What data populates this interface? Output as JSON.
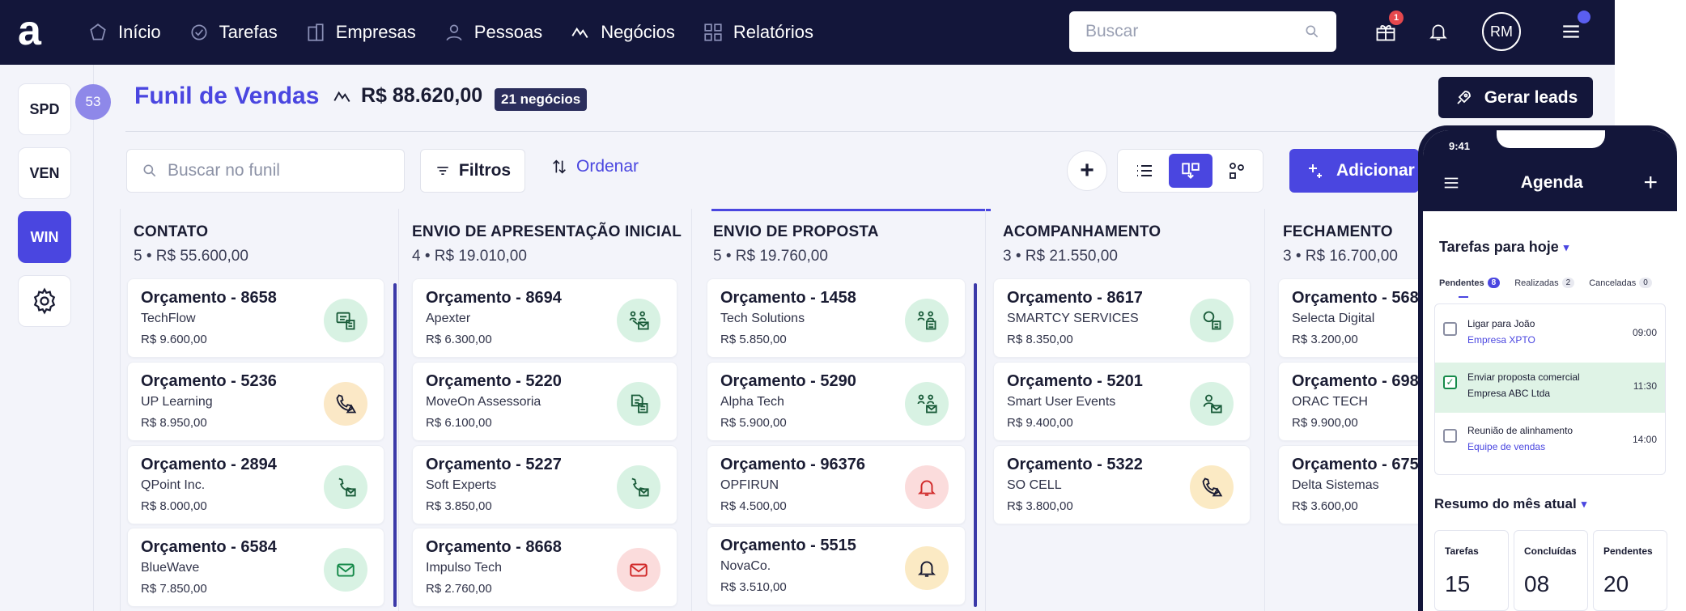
{
  "nav": {
    "logo": "a",
    "items": [
      {
        "label": "Início",
        "icon": "home-icon"
      },
      {
        "label": "Tarefas",
        "icon": "tasks-icon"
      },
      {
        "label": "Empresas",
        "icon": "building-icon"
      },
      {
        "label": "Pessoas",
        "icon": "person-icon"
      },
      {
        "label": "Negócios",
        "icon": "deals-icon"
      },
      {
        "label": "Relatórios",
        "icon": "reports-icon"
      }
    ],
    "search_placeholder": "Buscar",
    "gift_badge": "1",
    "avatar_initials": "RM"
  },
  "sidebar": {
    "buttons": [
      "SPD",
      "VEN",
      "WIN"
    ],
    "active": "WIN",
    "count": "53"
  },
  "header": {
    "title": "Funil de Vendas",
    "total": "R$ 88.620,00",
    "deals_badge": "21 negócios",
    "gen_leads": "Gerar leads"
  },
  "toolbar": {
    "search_placeholder": "Buscar no funil",
    "filters": "Filtros",
    "order": "Ordenar",
    "add": "Adicionar"
  },
  "columns": [
    {
      "name": "CONTATO",
      "count": "5",
      "sum": "R$ 55.600,00",
      "cards": [
        {
          "title": "Orçamento - 8658",
          "company": "TechFlow",
          "value": "R$ 9.600,00",
          "icon": "chat-document-icon",
          "tone": "green"
        },
        {
          "title": "Orçamento - 5236",
          "company": "UP Learning",
          "value": "R$ 8.950,00",
          "icon": "phone-warning-icon",
          "tone": "orange"
        },
        {
          "title": "Orçamento - 2894",
          "company": "QPoint Inc.",
          "value": "R$ 8.000,00",
          "icon": "phone-mail-icon",
          "tone": "green"
        },
        {
          "title": "Orçamento - 6584",
          "company": "BlueWave",
          "value": "R$ 7.850,00",
          "icon": "mail-icon",
          "tone": "green"
        }
      ]
    },
    {
      "name": "ENVIO DE APRESENTAÇÃO INICIAL",
      "count": "4",
      "sum": "R$ 19.010,00",
      "cards": [
        {
          "title": "Orçamento - 8694",
          "company": "Apexter",
          "value": "R$ 6.300,00",
          "icon": "meeting-mail-icon",
          "tone": "green"
        },
        {
          "title": "Orçamento - 5220",
          "company": "MoveOn Assessoria",
          "value": "R$ 6.100,00",
          "icon": "document-icon",
          "tone": "green"
        },
        {
          "title": "Orçamento - 5227",
          "company": "Soft Experts",
          "value": "R$ 3.850,00",
          "icon": "phone-mail-icon",
          "tone": "green"
        },
        {
          "title": "Orçamento - 8668",
          "company": "Impulso Tech",
          "value": "R$ 2.760,00",
          "icon": "mail-icon",
          "tone": "red"
        }
      ]
    },
    {
      "name": "ENVIO DE PROPOSTA",
      "count": "5",
      "sum": "R$ 19.760,00",
      "cards": [
        {
          "title": "Orçamento - 1458",
          "company": "Tech Solutions",
          "value": "R$ 5.850,00",
          "icon": "meeting-document-icon",
          "tone": "green"
        },
        {
          "title": "Orçamento - 5290",
          "company": "Alpha Tech",
          "value": "R$ 5.900,00",
          "icon": "meeting-mail-icon",
          "tone": "green"
        },
        {
          "title": "Orçamento - 96376",
          "company": "OPFIRUN",
          "value": "R$ 4.500,00",
          "icon": "bell-icon",
          "tone": "red"
        },
        {
          "title": "Orçamento - 5515",
          "company": "NovaCo.",
          "value": "R$ 3.510,00",
          "icon": "bell-icon",
          "tone": "yellow"
        }
      ]
    },
    {
      "name": "ACOMPANHAMENTO",
      "count": "3",
      "sum": "R$ 21.550,00",
      "cards": [
        {
          "title": "Orçamento - 8617",
          "company": "SMARTCY SERVICES",
          "value": "R$ 8.350,00",
          "icon": "search-document-icon",
          "tone": "green"
        },
        {
          "title": "Orçamento - 5201",
          "company": "Smart User Events",
          "value": "R$ 9.400,00",
          "icon": "person-mail-icon",
          "tone": "green"
        },
        {
          "title": "Orçamento - 5322",
          "company": "SO CELL",
          "value": "R$ 3.800,00",
          "icon": "phone-warning-icon",
          "tone": "yellow"
        }
      ]
    },
    {
      "name": "FECHAMENTO",
      "count": "3",
      "sum": "R$ 16.700,00",
      "cards": [
        {
          "title": "Orçamento - 568",
          "company": "Selecta Digital",
          "value": "R$ 3.200,00"
        },
        {
          "title": "Orçamento - 698",
          "company": "ORAC TECH",
          "value": "R$ 9.900,00"
        },
        {
          "title": "Orçamento - 675",
          "company": "Delta Sistemas",
          "value": "R$ 3.600,00"
        }
      ]
    }
  ],
  "phone": {
    "time": "9:41",
    "title": "Agenda",
    "today_title": "Tarefas para hoje",
    "tabs": [
      {
        "label": "Pendentes",
        "count": "8"
      },
      {
        "label": "Realizadas",
        "count": "2"
      },
      {
        "label": "Canceladas",
        "count": "0"
      }
    ],
    "tasks": [
      {
        "title": "Ligar para João",
        "sub": "Empresa XPTO",
        "time": "09:00",
        "done": false
      },
      {
        "title": "Enviar proposta comercial",
        "sub": "Empresa ABC Ltda",
        "time": "11:30",
        "done": true
      },
      {
        "title": "Reunião de alinhamento",
        "sub": "Equipe de vendas",
        "time": "14:00",
        "done": false
      }
    ],
    "month_title": "Resumo do mês atual",
    "stats": [
      {
        "label": "Tarefas",
        "value": "15"
      },
      {
        "label": "Concluídas",
        "value": "08"
      },
      {
        "label": "Pendentes",
        "value": "20"
      }
    ]
  },
  "colors": {
    "accent": "#4a46e0",
    "navy": "#13163a",
    "green_bg": "#d8f2e3",
    "red_bg": "#fbdcdc",
    "yellow_bg": "#fbeac4"
  }
}
